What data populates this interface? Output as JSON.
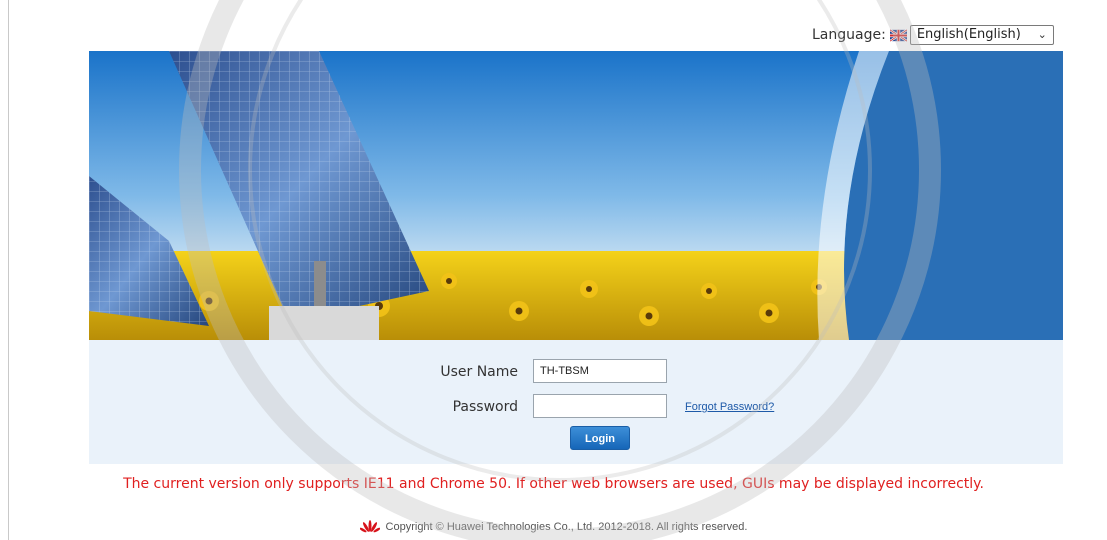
{
  "language": {
    "label": "Language:",
    "flag_icon": "uk-flag-icon",
    "selected": "English(English)",
    "chevron_icon": "chevron-down-icon"
  },
  "banner": {
    "image": "solar-panels-sunflower-field",
    "accent_color": "#2a6fb6"
  },
  "login": {
    "username_label": "User Name",
    "username_value": "TH-TBSM",
    "password_label": "Password",
    "password_value": "",
    "forgot_link": "Forgot Password?",
    "login_button": "Login"
  },
  "warning": "The current version only supports IE11 and Chrome 50. If other web browsers are used, GUIs may be displayed incorrectly.",
  "footer": {
    "copyright": "Copyright © Huawei Technologies Co., Ltd. 2012-2018. All rights reserved.",
    "logo_icon": "huawei-logo-icon"
  },
  "colors": {
    "panel_bg": "#eaf2fa",
    "warning_text": "#e02020",
    "link": "#1e5aa8"
  }
}
